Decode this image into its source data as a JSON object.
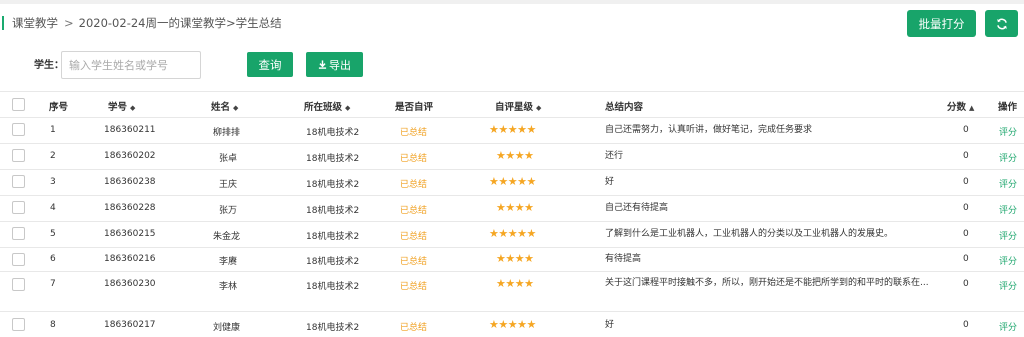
{
  "breadcrumb": {
    "root": "课堂教学",
    "separator": ">",
    "path": "2020-02-24周一的课堂教学>学生总结"
  },
  "toolbar": {
    "batch_grade_label": "批量打分",
    "refresh_icon": "refresh-icon"
  },
  "filter": {
    "label": "学生：",
    "placeholder": "输入学生姓名或学号",
    "value": "",
    "query_label": "查询",
    "export_label": "导出",
    "export_icon": "download-icon"
  },
  "table": {
    "headers": {
      "index": "序号",
      "student_id": "学号",
      "name": "姓名",
      "class": "所在班级",
      "self_eval": "是否自评",
      "stars": "自评星级",
      "summary": "总结内容",
      "score": "分数",
      "action": "操作"
    },
    "rows": [
      {
        "index": "1",
        "student_id": "186360211",
        "name": "柳排排",
        "class": "18机电技术2",
        "self_eval": "已总结",
        "stars": 5,
        "star_text": "★★★★★",
        "summary": "自己还需努力，认真听讲，做好笔记，完成任务要求",
        "score": "0",
        "action": "评分"
      },
      {
        "index": "2",
        "student_id": "186360202",
        "name": "张卓",
        "class": "18机电技术2",
        "self_eval": "已总结",
        "stars": 4,
        "star_text": "★★★★",
        "summary": "还行",
        "score": "0",
        "action": "评分"
      },
      {
        "index": "3",
        "student_id": "186360238",
        "name": "王庆",
        "class": "18机电技术2",
        "self_eval": "已总结",
        "stars": 5,
        "star_text": "★★★★★",
        "summary": "好",
        "score": "0",
        "action": "评分"
      },
      {
        "index": "4",
        "student_id": "186360228",
        "name": "张万",
        "class": "18机电技术2",
        "self_eval": "已总结",
        "stars": 4,
        "star_text": "★★★★",
        "summary": "自己还有待提高",
        "score": "0",
        "action": "评分"
      },
      {
        "index": "5",
        "student_id": "186360215",
        "name": "朱金龙",
        "class": "18机电技术2",
        "self_eval": "已总结",
        "stars": 5,
        "star_text": "★★★★★",
        "summary": "了解到什么是工业机器人，工业机器人的分类以及工业机器人的发展史。",
        "score": "0",
        "action": "评分"
      },
      {
        "index": "6",
        "student_id": "186360216",
        "name": "李赓",
        "class": "18机电技术2",
        "self_eval": "已总结",
        "stars": 4,
        "star_text": "★★★★",
        "summary": "有待提高",
        "score": "0",
        "action": "评分"
      },
      {
        "index": "7",
        "student_id": "186360230",
        "name": "李林",
        "class": "18机电技术2",
        "self_eval": "已总结",
        "stars": 4,
        "star_text": "★★★★",
        "summary": "关于这门课程平时接触不多，所以，刚开始还是不能把所学到的和平时的联系在...",
        "score": "0",
        "action": "评分"
      },
      {
        "index": "8",
        "student_id": "186360217",
        "name": "刘健康",
        "class": "18机电技术2",
        "self_eval": "已总结",
        "stars": 5,
        "star_text": "★★★★★",
        "summary": "好",
        "score": "0",
        "action": "评分"
      }
    ]
  },
  "colors": {
    "accent": "#18a46a",
    "status": "#f0a020",
    "star": "#f5a623"
  }
}
